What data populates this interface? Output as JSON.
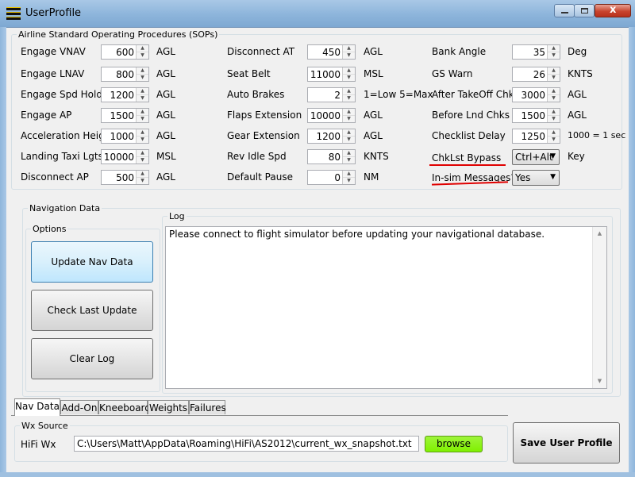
{
  "window": {
    "title": "UserProfile",
    "close_glyph": "x"
  },
  "sops": {
    "legend": "Airline Standard Operating Procedures (SOPs)",
    "col1": [
      {
        "label": "Engage VNAV",
        "value": "600",
        "unit": "AGL"
      },
      {
        "label": "Engage LNAV",
        "value": "800",
        "unit": "AGL"
      },
      {
        "label": "Engage Spd Hold",
        "value": "1200",
        "unit": "AGL"
      },
      {
        "label": "Engage AP",
        "value": "1500",
        "unit": "AGL"
      },
      {
        "label": "Acceleration Height",
        "value": "1000",
        "unit": "AGL"
      },
      {
        "label": "Landing  Taxi Lgts",
        "value": "10000",
        "unit": "MSL"
      },
      {
        "label": "Disconnect AP",
        "value": "500",
        "unit": "AGL"
      }
    ],
    "col2": [
      {
        "label": "Disconnect AT",
        "value": "450",
        "unit": "AGL"
      },
      {
        "label": "Seat Belt",
        "value": "11000",
        "unit": "MSL"
      },
      {
        "label": "Auto Brakes",
        "value": "2",
        "unit": "1=Low 5=Max"
      },
      {
        "label": "Flaps Extension",
        "value": "10000",
        "unit": "AGL"
      },
      {
        "label": "Gear Extension",
        "value": "1200",
        "unit": "AGL"
      },
      {
        "label": "Rev Idle Spd",
        "value": "80",
        "unit": "KNTS"
      },
      {
        "label": "Default Pause",
        "value": "0",
        "unit": "NM"
      }
    ],
    "col3": [
      {
        "label": "Bank Angle",
        "value": "35",
        "unit": "Deg"
      },
      {
        "label": "GS Warn",
        "value": "26",
        "unit": "KNTS"
      },
      {
        "label": "After TakeOff Chks",
        "value": "3000",
        "unit": "AGL"
      },
      {
        "label": "Before Lnd Chks",
        "value": "1500",
        "unit": "AGL"
      },
      {
        "label": "Checklist Delay",
        "value": "1250",
        "unit": "1000 = 1 sec"
      }
    ],
    "chklst_bypass": {
      "label": "ChkLst Bypass",
      "value": "Ctrl+Alt",
      "unit": "Key"
    },
    "insim_messages": {
      "label": "In-sim Messages?",
      "value": "Yes"
    }
  },
  "nav": {
    "legend": "Navigation Data",
    "options_legend": "Options",
    "buttons": {
      "update": "Update Nav Data",
      "check": "Check Last Update",
      "clear": "Clear Log"
    },
    "log_legend": "Log",
    "log_text": "Please connect to flight simulator before updating your navigational database."
  },
  "tabs": [
    "Nav Data",
    "Add-On",
    "Kneeboard",
    "Weights",
    "Failures"
  ],
  "wx": {
    "legend": "Wx Source",
    "label": "HiFi Wx",
    "path": "C:\\Users\\Matt\\AppData\\Roaming\\HiFi\\AS2012\\current_wx_snapshot.txt",
    "browse": "browse"
  },
  "save_button": "Save User Profile",
  "colors": {
    "accent_red": "#e00000",
    "browse_green": "#80f000"
  }
}
